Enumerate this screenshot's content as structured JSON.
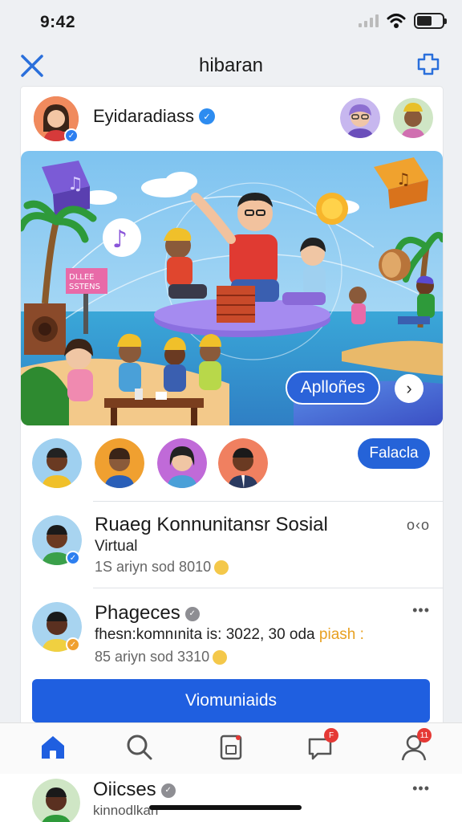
{
  "status": {
    "time": "9:42"
  },
  "nav": {
    "title": "hibaran"
  },
  "author": {
    "name": "Eyidaradiass"
  },
  "banner": {
    "button_label": "Aplloñes"
  },
  "people": {
    "follow_label": "Falacla"
  },
  "posts": [
    {
      "title": "Ruaeg Konnunitansr Sosial",
      "subtitle": "Virtual",
      "meta": "1S ariyn sod 8010",
      "more": "o‹o"
    },
    {
      "title": "Phageces",
      "subtitle": "fhesn:komnınita is: 3022, 30 oda",
      "subtitle_accent": "piash :",
      "meta": "85 ariyn sod 3310",
      "more": "•••"
    }
  ],
  "join_button": {
    "label": "Viomuniaids"
  },
  "tabs": [
    {
      "name": "home",
      "badge": ""
    },
    {
      "name": "search",
      "badge": ""
    },
    {
      "name": "saved",
      "badge": ""
    },
    {
      "name": "chat",
      "badge": "F"
    },
    {
      "name": "profile",
      "badge": "11"
    }
  ],
  "peek_post": {
    "title": "Oiicses",
    "subtitle": "kinnodlkan",
    "more": "•••"
  },
  "colors": {
    "primary": "#1f5fe0",
    "accent_blue": "#2d8cf0",
    "nav_icon": "#2a6fdb"
  }
}
